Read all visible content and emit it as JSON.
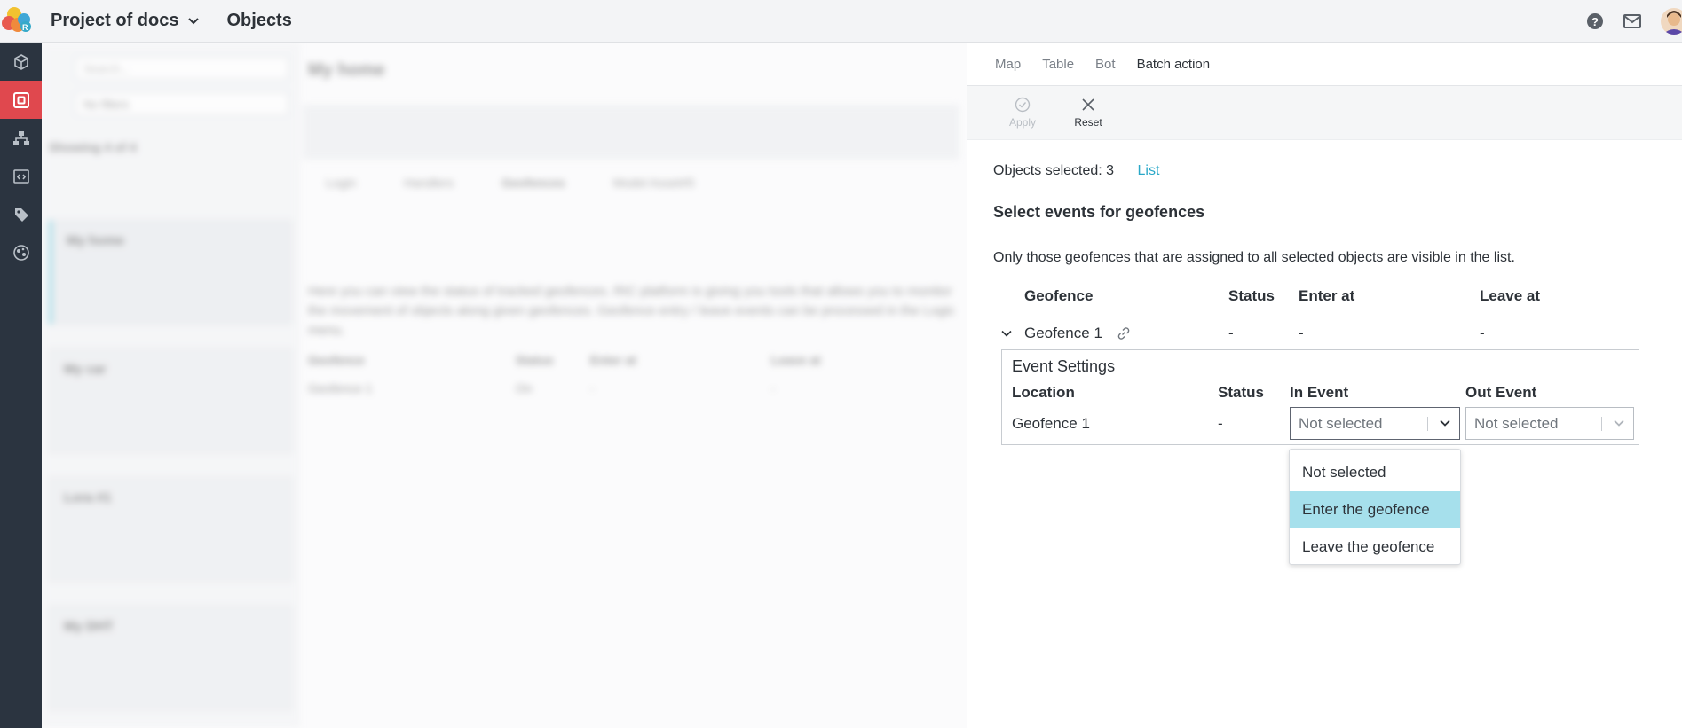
{
  "header": {
    "project_name": "Project of docs",
    "section_title": "Objects",
    "icons": [
      "logo-icon",
      "chevron-down-icon",
      "help-icon",
      "mail-icon",
      "avatar"
    ]
  },
  "rail": {
    "items": [
      "cube-icon",
      "objects-icon",
      "hierarchy-icon",
      "code-icon",
      "tag-icon",
      "globe-icon"
    ],
    "active_index": 1
  },
  "background": {
    "search_placeholder": "Search...",
    "filter_value": "No filters",
    "showing": "Showing 4 of 4",
    "cards": [
      "My home",
      "My car",
      "Lora #1",
      "My DHT"
    ],
    "page_title": "My home",
    "subtabs": [
      "Login",
      "Handlers",
      "Geofences",
      "Model Asset#5"
    ],
    "description": "Here you can view the status of tracked geofences. RIC platform is giving you tools that allows you to monitor the movement of objects along given geofences. Geofence entry / leave events can be processed in the Logic menu.",
    "table_headers": [
      "Geofence",
      "Status",
      "Enter at",
      "Leave at"
    ],
    "table_row": [
      "Geofence 1",
      "On",
      "-",
      "-"
    ]
  },
  "panel": {
    "tabs": [
      "Map",
      "Table",
      "Bot",
      "Batch action"
    ],
    "active_tab": 3,
    "toolbar": {
      "apply_label": "Apply",
      "reset_label": "Reset"
    },
    "objects_selected": "Objects selected: 3",
    "list_link": "List",
    "heading": "Select events for geofences",
    "info": "Only those geofences that are assigned to all selected objects are visible in the list.",
    "geofence_table": {
      "headers": [
        "Geofence",
        "Status",
        "Enter at",
        "Leave at"
      ],
      "row": {
        "name": "Geofence 1",
        "status": "-",
        "enter_at": "-",
        "leave_at": "-"
      }
    },
    "event_settings": {
      "title": "Event Settings",
      "headers": [
        "Location",
        "Status",
        "In Event",
        "Out Event"
      ],
      "row": {
        "location": "Geofence 1",
        "status": "-",
        "in_event": "Not selected",
        "out_event": "Not selected"
      }
    },
    "dropdown": {
      "options": [
        "Not selected",
        "Enter the geofence",
        "Leave the geofence"
      ],
      "highlighted_index": 1
    }
  },
  "colors": {
    "rail_bg": "#2b3440",
    "rail_active": "#e0484e",
    "link": "#2aa8c8",
    "highlight": "#a6e0ec"
  }
}
